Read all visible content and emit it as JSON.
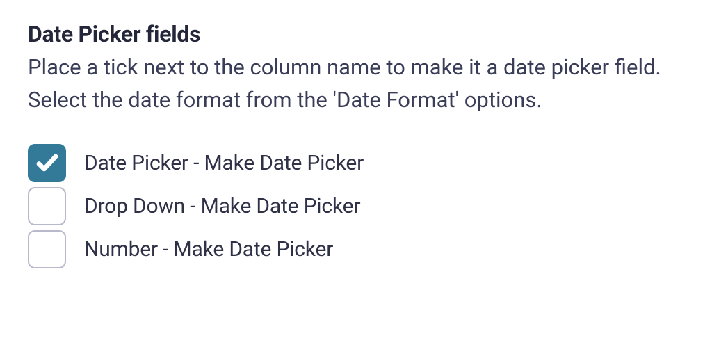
{
  "section": {
    "heading": "Date Picker fields",
    "description": "Place a tick next to the column name to make it a date picker field. Select the date format from the 'Date Format' options."
  },
  "options": [
    {
      "label": "Date Picker - Make Date Picker",
      "checked": true
    },
    {
      "label": "Drop Down - Make Date Picker",
      "checked": false
    },
    {
      "label": "Number - Make Date Picker",
      "checked": false
    }
  ],
  "colors": {
    "accent": "#337a99",
    "text": "#2b2e45",
    "border": "#b8b9cc"
  }
}
